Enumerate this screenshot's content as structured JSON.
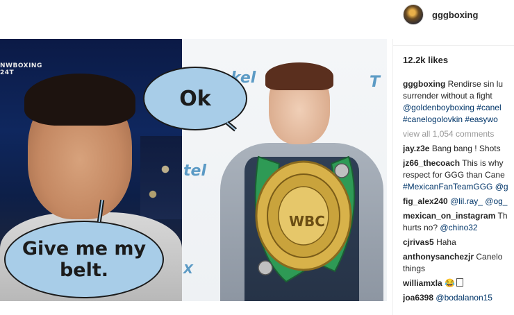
{
  "post": {
    "image": {
      "ticker_text": "NWBOXING 24T",
      "banner_texts": [
        "kel",
        "T",
        "tel",
        "X"
      ],
      "bubble_ok": "Ok",
      "bubble_belt": "Give me my belt.",
      "belt_text": "WBC"
    }
  },
  "sidebar": {
    "header": {
      "username": "gggboxing"
    },
    "likes": "12.2k likes",
    "caption": {
      "user": "gggboxing",
      "lines": [
        "Rendirse sin lu",
        "surrender without a fight"
      ],
      "tags_line1": [
        "@goldenboyboxing",
        "#canel"
      ],
      "tags_line2": [
        "#canelogolovkin",
        "#easywo"
      ]
    },
    "view_all": "view all 1,054 comments",
    "comments": [
      {
        "user": "jay.z3e",
        "text": "Bang bang ! Shots"
      },
      {
        "user": "jz66_thecoach",
        "text": "This is why",
        "line2": "respect for GGG than Cane",
        "line3_link": "#MexicanFanTeamGGG",
        "line3_tail": "@g"
      },
      {
        "user": "fig_alex240",
        "link1": "@lil.ray_",
        "link2": "@og_"
      },
      {
        "user": "mexican_on_instagram",
        "text": "Th",
        "line2_text": "hurts no?",
        "line2_link": "@chino32"
      },
      {
        "user": "cjrivas5",
        "text": "Haha"
      },
      {
        "user": "anthonysanchezjr",
        "text": "Canelo",
        "line2": "things"
      },
      {
        "user": "williamxla",
        "text": ""
      },
      {
        "user": "joa6398",
        "link1": "@bodalanon15"
      }
    ]
  },
  "colors": {
    "bubble": "#a8cde8",
    "link": "#003569",
    "muted": "#999999",
    "belt_green": "#2e9a55",
    "belt_gold": "#d8b24a"
  }
}
